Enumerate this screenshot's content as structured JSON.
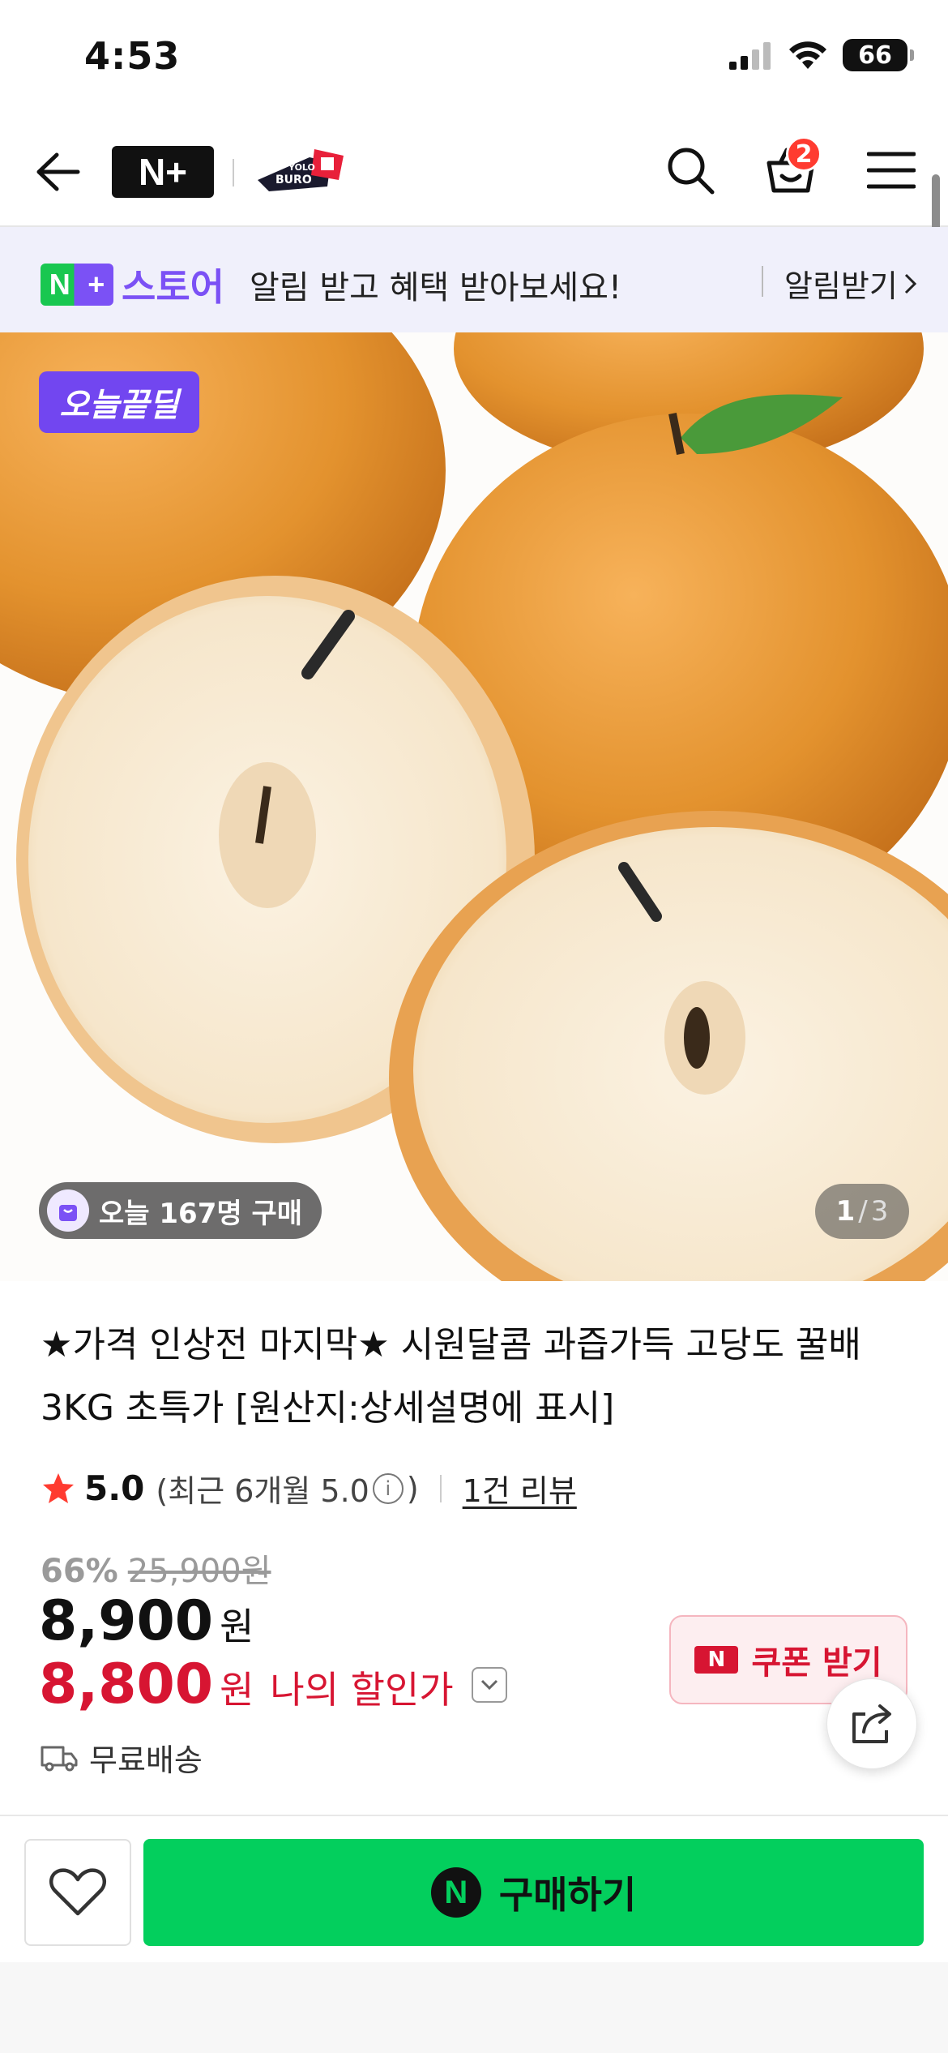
{
  "status_bar": {
    "time": "4:53",
    "battery": "66"
  },
  "nav": {
    "cart_count": "2"
  },
  "store_banner": {
    "store_name": "스토어",
    "message": "알림 받고 혜택 받아보세요!",
    "action": "알림받기"
  },
  "product_image": {
    "deal_badge": "오늘끝딜",
    "buy_count": "오늘 167명 구매",
    "pager_current": "1",
    "pager_sep": "/",
    "pager_total": "3"
  },
  "product": {
    "title": "★가격 인상전 마지막★ 시원달콤 과즙가득 고당도 꿀배 3KG 초특가 [원산지:상세설명에 표시]",
    "rating_score": "5.0",
    "rating_recent": "(최근 6개월 5.0",
    "rating_recent_close": ")",
    "review_link": "1건 리뷰",
    "discount_pct": "66%",
    "original_price": "25,900원",
    "price": "8,900",
    "price_unit": "원",
    "my_price": "8,800",
    "my_price_unit": "원",
    "my_price_label": "나의 할인가",
    "coupon_label": "쿠폰 받기",
    "shipping": "무료배송"
  },
  "bottom_bar": {
    "buy_label": "구매하기"
  },
  "colors": {
    "accent_purple": "#7246f0",
    "naver_green": "#03cf5d",
    "sale_red": "#d71532"
  }
}
